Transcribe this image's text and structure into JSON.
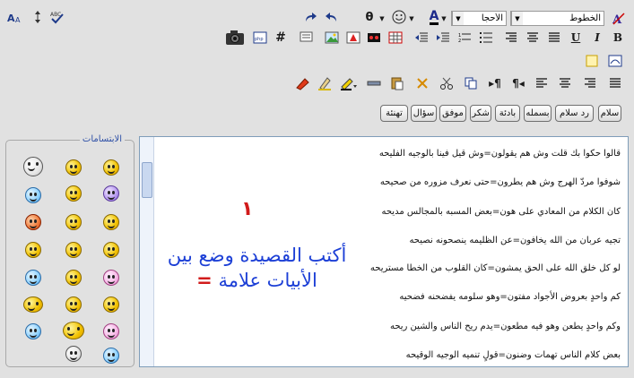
{
  "toolbar": {
    "font_select": "الخطوط",
    "size_select": "الأحجا",
    "text_color_letter": "A",
    "icons_row1": [
      "format-icon",
      "font-color-icon",
      "smiley-icon",
      "special-char-icon",
      "undo-icon",
      "redo-icon"
    ],
    "icons_row2": [
      "bold-icon",
      "italic-icon",
      "underline-icon",
      "align-justify-icon",
      "align-center-icon",
      "align-right-icon",
      "list-icon",
      "indent-icon",
      "outdent-icon",
      "table-icon",
      "image-icon",
      "flash-icon",
      "media-icon",
      "hash-icon",
      "html-icon",
      "camera-icon"
    ],
    "icons_row3": [
      "justify-icon",
      "align-right2-icon",
      "align-center2-icon",
      "align-left-icon",
      "rtl-icon",
      "ltr-icon",
      "copy-icon",
      "cut-icon",
      "delete-icon",
      "paste-icon",
      "hr-icon",
      "highlight-icon",
      "eraser-icon"
    ],
    "right_icons": [
      "font-size-icon",
      "line-height-icon",
      "spellcheck-icon"
    ]
  },
  "quick_buttons": [
    "سلام",
    "رد سلام",
    "بسمله",
    "بادئة",
    "شكر",
    "موفق",
    "سؤال",
    "تهنئة"
  ],
  "editor": {
    "lines": [
      "قالوا حكوا بك قلت وش هم يقولون=وش قيل فينا بالوجيه الفليحه",
      "شوفوا مردّ الهرج وش هم يطرون=حتى نعرف مزوره من صحيحه",
      "كان الكلام من المعادي على هون=بعض المسبه بالمجالس مديحه",
      "تجيه عربان من الله يخافون=عن الظليمه ينصحونه نصيحه",
      "لو كل خلق الله على الحق يمشون=كان القلوب من الخطا مستريحه",
      "كم واحدٍ بعروض الأجواد مفتون=وهو سلومه يفضحنه فضحيه",
      "وكم واحدٍ يطعن وهو فيه مطعون=يدم ريح الناس والشين ريحه",
      "بعض كلام الناس تهمات وضنون=قولٍ تنميه الوجيه الوقيحه"
    ],
    "number_annotation": "١",
    "instruction_line1": "أكتب القصيدة وضع بين",
    "instruction_line2": "الأبيات علامة",
    "instruction_sign": "="
  },
  "smileys_panel": {
    "title": "الابتسامات"
  },
  "colors": {
    "background": "#e1e1e1",
    "annotation_red": "#d11b1b",
    "annotation_blue": "#1c3fd6"
  }
}
